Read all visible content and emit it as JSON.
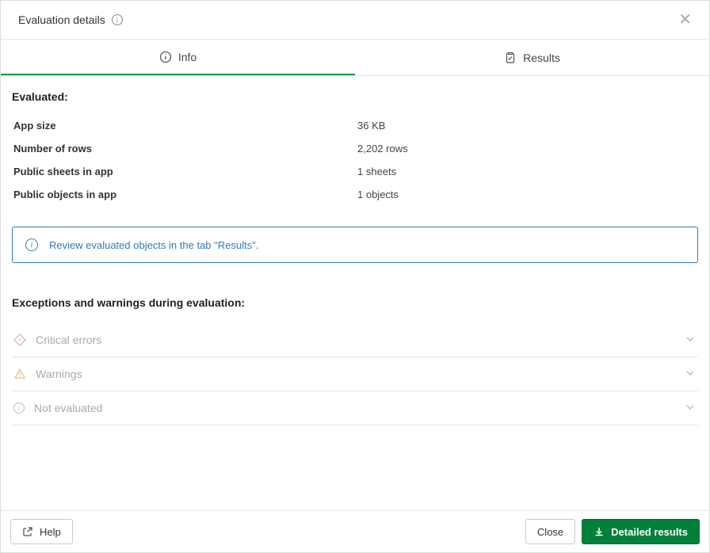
{
  "header": {
    "title": "Evaluation details"
  },
  "tabs": {
    "info_label": "Info",
    "results_label": "Results"
  },
  "evaluated": {
    "title": "Evaluated:",
    "rows": [
      {
        "label": "App size",
        "value": "36 KB"
      },
      {
        "label": "Number of rows",
        "value": "2,202 rows"
      },
      {
        "label": "Public sheets in app",
        "value": "1 sheets"
      },
      {
        "label": "Public objects in app",
        "value": "1 objects"
      }
    ]
  },
  "notice": {
    "text": "Review evaluated objects in the tab \"Results\"."
  },
  "exceptions": {
    "title": "Exceptions and warnings during evaluation:",
    "critical_label": "Critical errors",
    "warnings_label": "Warnings",
    "not_evaluated_label": "Not evaluated"
  },
  "footer": {
    "help_label": "Help",
    "close_label": "Close",
    "detailed_label": "Detailed results"
  }
}
